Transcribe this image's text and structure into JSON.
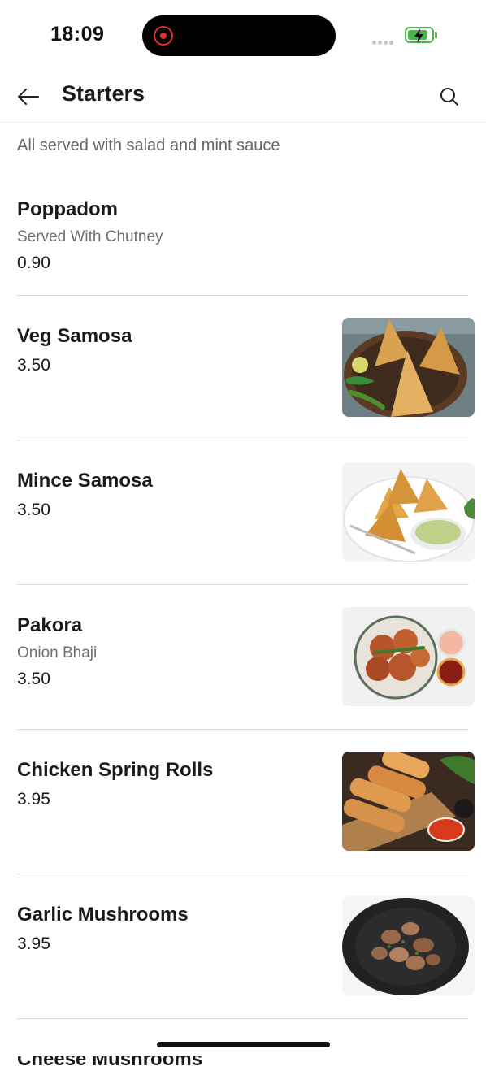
{
  "status_bar": {
    "time": "18:09",
    "recording_icon": "screen-record-icon",
    "signal_icon": "cellular-signal-icon",
    "battery_icon": "battery-charging-icon",
    "battery_color": "#4ab54a",
    "battery_level": 0.85
  },
  "header": {
    "back_icon": "arrow-left-icon",
    "title": "Starters",
    "search_icon": "search-icon"
  },
  "section": {
    "subtitle": "All served with salad and mint sauce"
  },
  "items": [
    {
      "name": "Poppadom",
      "description": "Served With Chutney",
      "price": "0.90",
      "has_image": false
    },
    {
      "name": "Veg Samosa",
      "description": "",
      "price": "3.50",
      "has_image": true,
      "image": "veg-samosa-photo"
    },
    {
      "name": "Mince Samosa",
      "description": "",
      "price": "3.50",
      "has_image": true,
      "image": "mince-samosa-photo"
    },
    {
      "name": "Pakora",
      "description": "Onion Bhaji",
      "price": "3.50",
      "has_image": true,
      "image": "pakora-photo"
    },
    {
      "name": "Chicken Spring Rolls",
      "description": "",
      "price": "3.95",
      "has_image": true,
      "image": "chicken-spring-rolls-photo"
    },
    {
      "name": "Garlic Mushrooms",
      "description": "",
      "price": "3.95",
      "has_image": true,
      "image": "garlic-mushrooms-photo"
    },
    {
      "name": "Cheese Mushrooms",
      "description": "",
      "price": "",
      "has_image": false
    }
  ]
}
